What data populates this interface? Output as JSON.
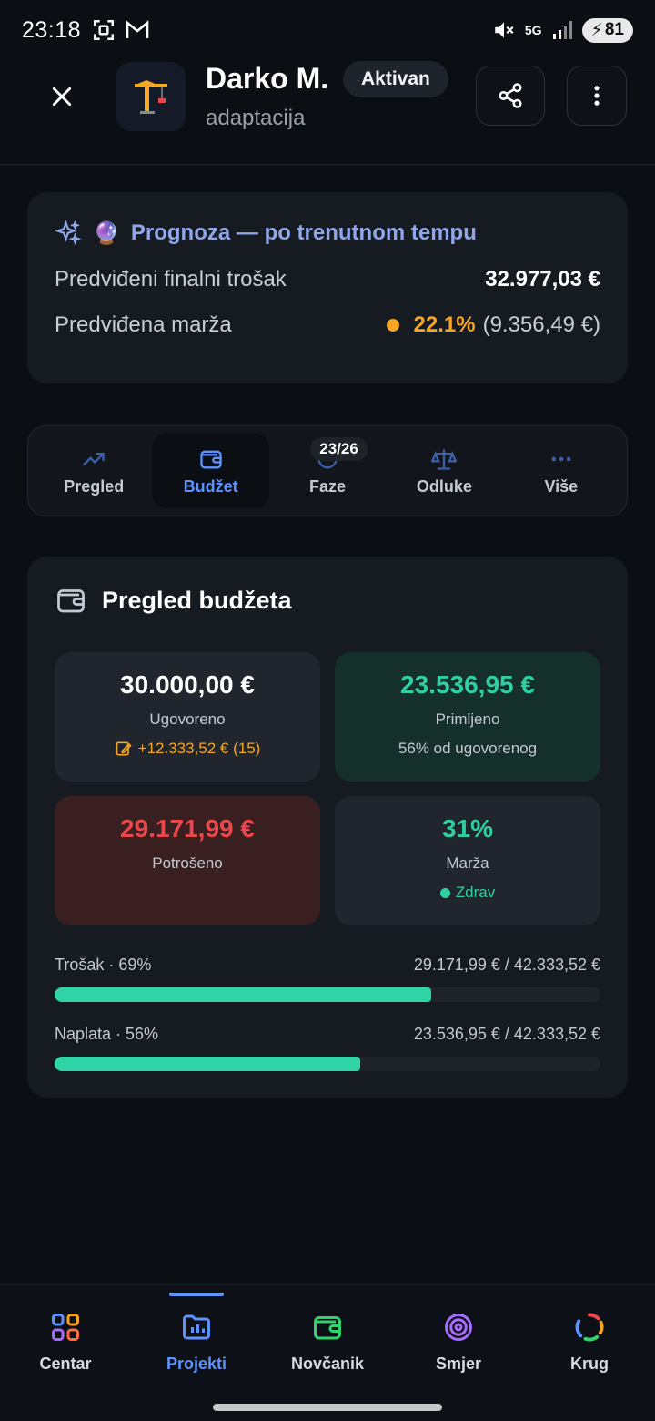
{
  "status_bar": {
    "time": "23:18",
    "network": "5G",
    "battery": "81"
  },
  "header": {
    "project_name": "Darko M.",
    "status": "Aktivan",
    "project_type": "adaptacija"
  },
  "forecast": {
    "title": "Prognoza — po trenutnom tempu",
    "emoji": "🔮",
    "final_cost_label": "Predviđeni finalni trošak",
    "final_cost_value": "32.977,03 €",
    "margin_label": "Predviđena marža",
    "margin_percent": "22.1%",
    "margin_amount": "(9.356,49 €)",
    "margin_color": "#f5a623"
  },
  "tabs": [
    {
      "label": "Pregled",
      "icon": "trending-up-icon"
    },
    {
      "label": "Budžet",
      "icon": "wallet-icon",
      "active": true
    },
    {
      "label": "Faze",
      "icon": "progress-icon",
      "badge": "23/26"
    },
    {
      "label": "Odluke",
      "icon": "scale-icon"
    },
    {
      "label": "Više",
      "icon": "more-horizontal-icon"
    }
  ],
  "budget": {
    "title": "Pregled budžeta",
    "contracted": {
      "value": "30.000,00 €",
      "label": "Ugovoreno",
      "sub": "+12.333,52 € (15)"
    },
    "received": {
      "value": "23.536,95 €",
      "label": "Primljeno",
      "sub": "56% od ugovorenog"
    },
    "spent": {
      "value": "29.171,99 €",
      "label": "Potrošeno"
    },
    "margin": {
      "value": "31%",
      "label": "Marža",
      "sub": "Zdrav"
    },
    "cost_progress": {
      "label": "Trošak · 69%",
      "amount": "29.171,99 € / 42.333,52 €",
      "percent": 69
    },
    "billing_progress": {
      "label": "Naplata · 56%",
      "amount": "23.536,95 € / 42.333,52 €",
      "percent": 56
    },
    "colors": {
      "positive": "#2fcfa3",
      "negative": "#e8474b",
      "warning": "#f5a623"
    }
  },
  "bottom_nav": [
    {
      "label": "Centar",
      "icon": "grid-icon"
    },
    {
      "label": "Projekti",
      "icon": "projects-icon",
      "active": true
    },
    {
      "label": "Novčanik",
      "icon": "wallet-icon"
    },
    {
      "label": "Smjer",
      "icon": "target-icon"
    },
    {
      "label": "Krug",
      "icon": "circle-icon"
    }
  ],
  "accent_color": "#5c93ff"
}
